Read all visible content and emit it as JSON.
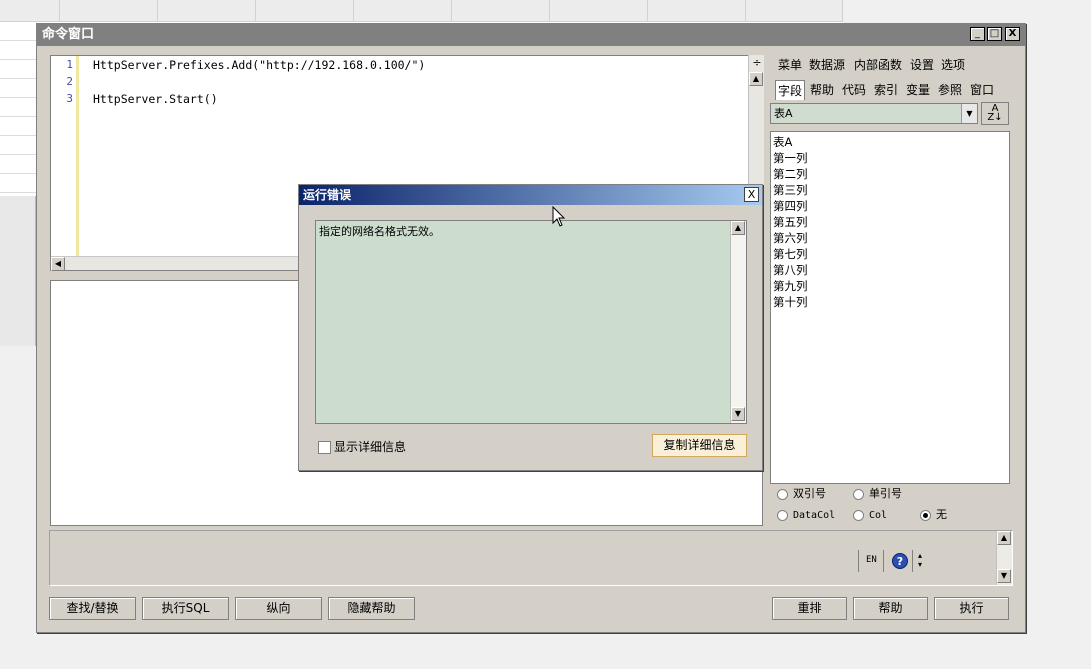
{
  "window": {
    "title": "命令窗口",
    "controls": [
      "_",
      "□",
      "X"
    ]
  },
  "editor": {
    "lines": [
      {
        "num": "1",
        "text": "HttpServer.Prefixes.Add(\"http://192.168.0.100/\")"
      },
      {
        "num": "2",
        "text": ""
      },
      {
        "num": "3",
        "text": "HttpServer.Start()"
      }
    ]
  },
  "panel": {
    "menu": [
      "菜单",
      "数据源",
      "内部函数",
      "设置",
      "选项"
    ],
    "tabs": [
      "字段",
      "帮助",
      "代码",
      "索引",
      "变量",
      "参照",
      "窗口"
    ],
    "active_tab": "字段",
    "table_select": "表A",
    "fields": [
      "表A",
      "第一列",
      "第二列",
      "第三列",
      "第四列",
      "第五列",
      "第六列",
      "第七列",
      "第八列",
      "第九列",
      "第十列"
    ],
    "quote_options": {
      "double": "双引号",
      "single": "单引号",
      "datacol": "DataCol",
      "col": "Col",
      "none": "无"
    },
    "selected_quote": "无"
  },
  "status": {
    "lang": "EN"
  },
  "buttons": {
    "find_replace": "查找/替换",
    "exec_sql": "执行SQL",
    "vertical": "纵向",
    "hide_help": "隐藏帮助",
    "rearrange": "重排",
    "help": "帮助",
    "execute": "执行"
  },
  "dialog": {
    "title": "运行错误",
    "close": "X",
    "message": "指定的网络名格式无效。",
    "show_details": "显示详细信息",
    "copy_details": "复制详细信息"
  },
  "colors": {
    "dialog_message_bg": "#ccdccd",
    "combo_bg": "#cfdccf",
    "window_bg": "#d4d0c8",
    "dialog_title_start": "#0a246a"
  }
}
